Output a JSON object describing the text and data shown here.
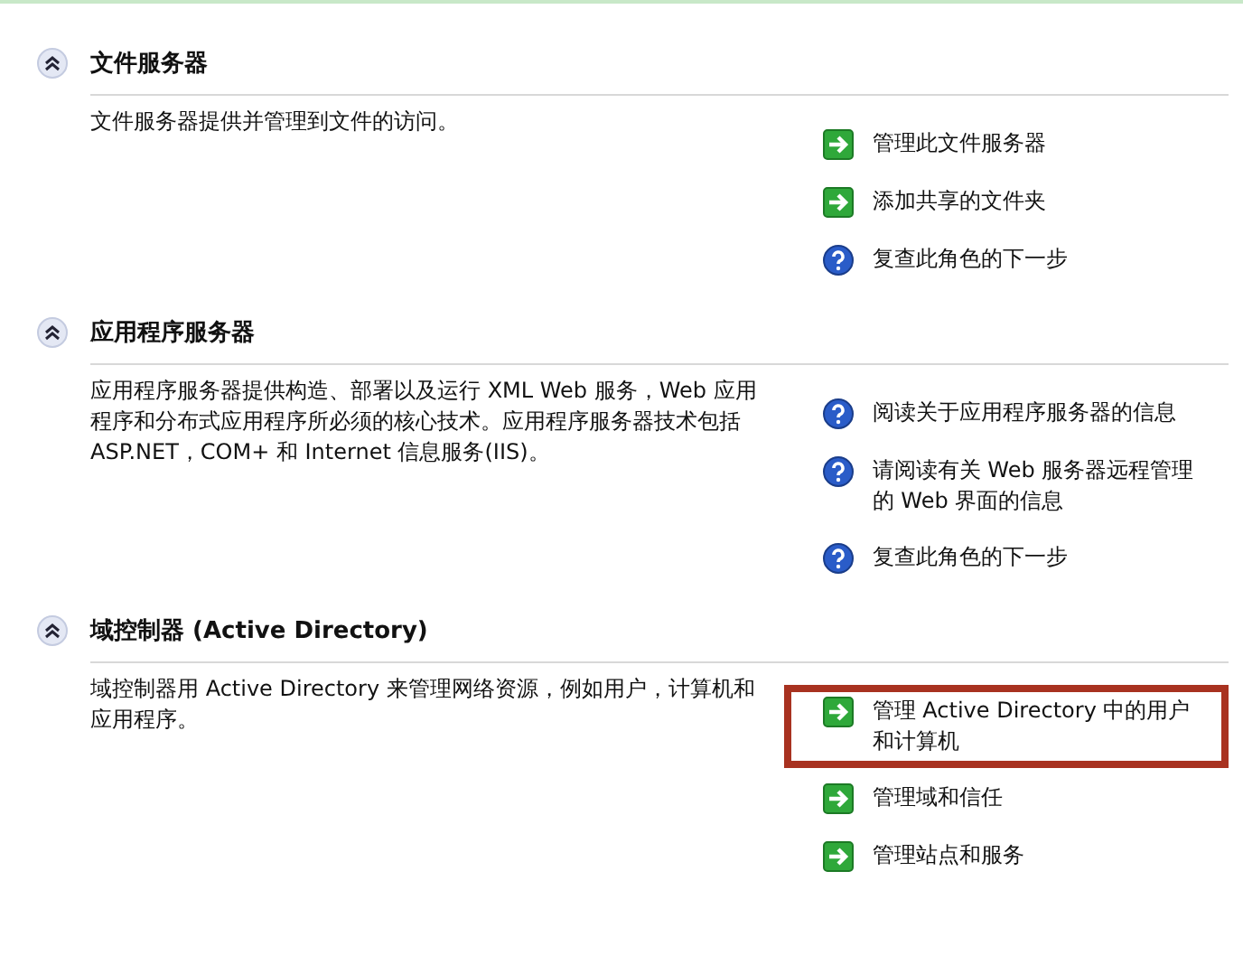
{
  "sections": [
    {
      "title": "文件服务器",
      "expanded": true,
      "description": "文件服务器提供并管理到文件的访问。",
      "links": [
        {
          "kind": "arrow",
          "label": "管理此文件服务器",
          "highlighted": false
        },
        {
          "kind": "arrow",
          "label": "添加共享的文件夹",
          "highlighted": false
        },
        {
          "kind": "help",
          "label": "复查此角色的下一步",
          "highlighted": false
        }
      ]
    },
    {
      "title": "应用程序服务器",
      "expanded": true,
      "description": "应用程序服务器提供构造、部署以及运行 XML Web 服务，Web 应用程序和分布式应用程序所必须的核心技术。应用程序服务器技术包括 ASP.NET，COM+ 和 Internet 信息服务(IIS)。",
      "links": [
        {
          "kind": "help",
          "label": "阅读关于应用程序服务器的信息",
          "highlighted": false
        },
        {
          "kind": "help",
          "label": "请阅读有关 Web 服务器远程管理的 Web 界面的信息",
          "highlighted": false
        },
        {
          "kind": "help",
          "label": "复查此角色的下一步",
          "highlighted": false
        }
      ]
    },
    {
      "title": "域控制器 (Active Directory)",
      "expanded": true,
      "description": "域控制器用 Active Directory 来管理网络资源，例如用户，计算机和应用程序。",
      "links": [
        {
          "kind": "arrow",
          "label": "管理 Active Directory 中的用户和计算机",
          "highlighted": true
        },
        {
          "kind": "arrow",
          "label": "管理域和信任",
          "highlighted": false
        },
        {
          "kind": "arrow",
          "label": "管理站点和服务",
          "highlighted": false
        }
      ]
    }
  ]
}
